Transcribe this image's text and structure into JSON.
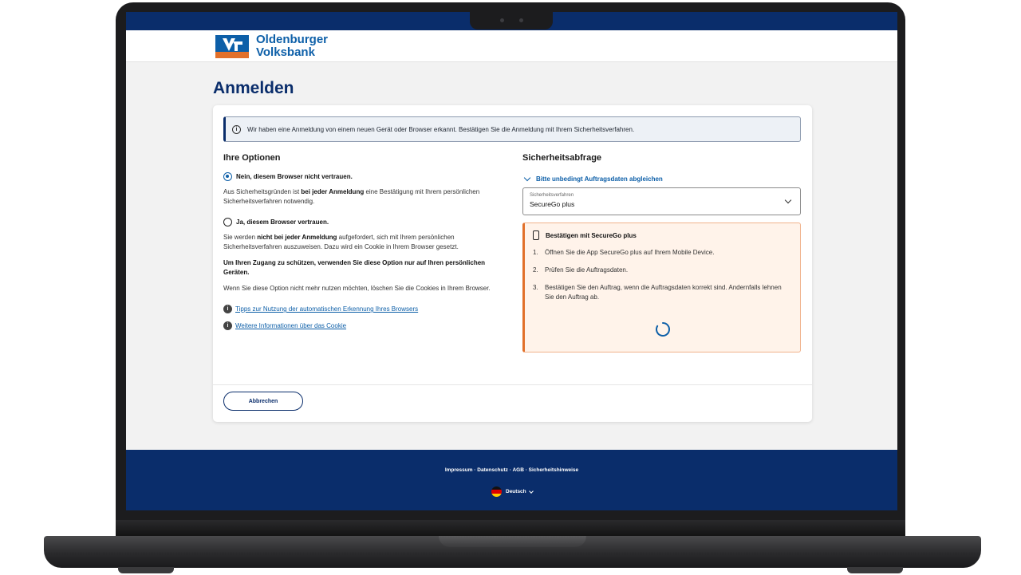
{
  "brand": {
    "name_line1": "Oldenburger",
    "name_line2": "Volksbank",
    "colors": {
      "primary": "#0a2d6b",
      "accent": "#0d5fa8",
      "logo_orange": "#e2702a",
      "warning_panel": "#fff3ea"
    }
  },
  "page": {
    "title": "Anmelden"
  },
  "banner": {
    "text": "Wir haben eine Anmeldung von einem neuen Gerät oder Browser erkannt. Bestätigen Sie die Anmeldung mit Ihrem Sicherheitsverfahren."
  },
  "options": {
    "title": "Ihre Optionen",
    "radio_no": {
      "label": "Nein, diesem Browser nicht vertrauen.",
      "checked": true
    },
    "para_no": {
      "a": "Aus Sicherheitsgründen ist ",
      "b": "bei jeder Anmeldung",
      "c": " eine Bestätigung mit Ihrem persönlichen Sicherheitsverfahren notwendig."
    },
    "radio_yes": {
      "label": "Ja, diesem Browser vertrauen.",
      "checked": false
    },
    "para_yes": {
      "a": "Sie werden ",
      "b": "nicht bei jeder Anmeldung",
      "c": " aufgefordert, sich mit Ihrem persönlichen Sicherheitsverfahren auszuweisen. Dazu wird ein Cookie in Ihrem Browser gesetzt."
    },
    "para_warning": "Um Ihren Zugang zu schützen, verwenden Sie diese Option nur auf Ihren persönlichen Geräten.",
    "para_cookie": "Wenn Sie diese Option nicht mehr nutzen möchten, löschen Sie die Cookies in Ihrem Browser.",
    "links": [
      {
        "label": "Tipps zur Nutzung der automatischen Erkennung Ihres Browsers",
        "icon": "info-icon"
      },
      {
        "label": "Weitere Informationen über das Cookie",
        "icon": "info-icon"
      }
    ]
  },
  "security": {
    "title": "Sicherheitsabfrage",
    "collapse_label": "Bitte unbedingt Auftragsdaten abgleichen",
    "select": {
      "floating_label": "Sicherheitsverfahren",
      "value": "SecureGo plus"
    },
    "panel": {
      "title": "Bestätigen mit SecureGo plus",
      "icon": "smartphone-icon",
      "steps": [
        {
          "num": "1.",
          "text": "Öffnen Sie die App SecureGo plus auf Ihrem Mobile Device."
        },
        {
          "num": "2.",
          "text": "Prüfen Sie die Auftragsdaten."
        },
        {
          "num": "3.",
          "text": "Bestätigen Sie den Auftrag, wenn die Auftragsdaten korrekt sind. Andernfalls lehnen Sie den Auftrag ab."
        }
      ]
    }
  },
  "actions": {
    "cancel_label": "Abbrechen"
  },
  "footer": {
    "links_text": "Impressum · Datenschutz · AGB · Sicherheitshinweise",
    "language": "Deutsch"
  }
}
